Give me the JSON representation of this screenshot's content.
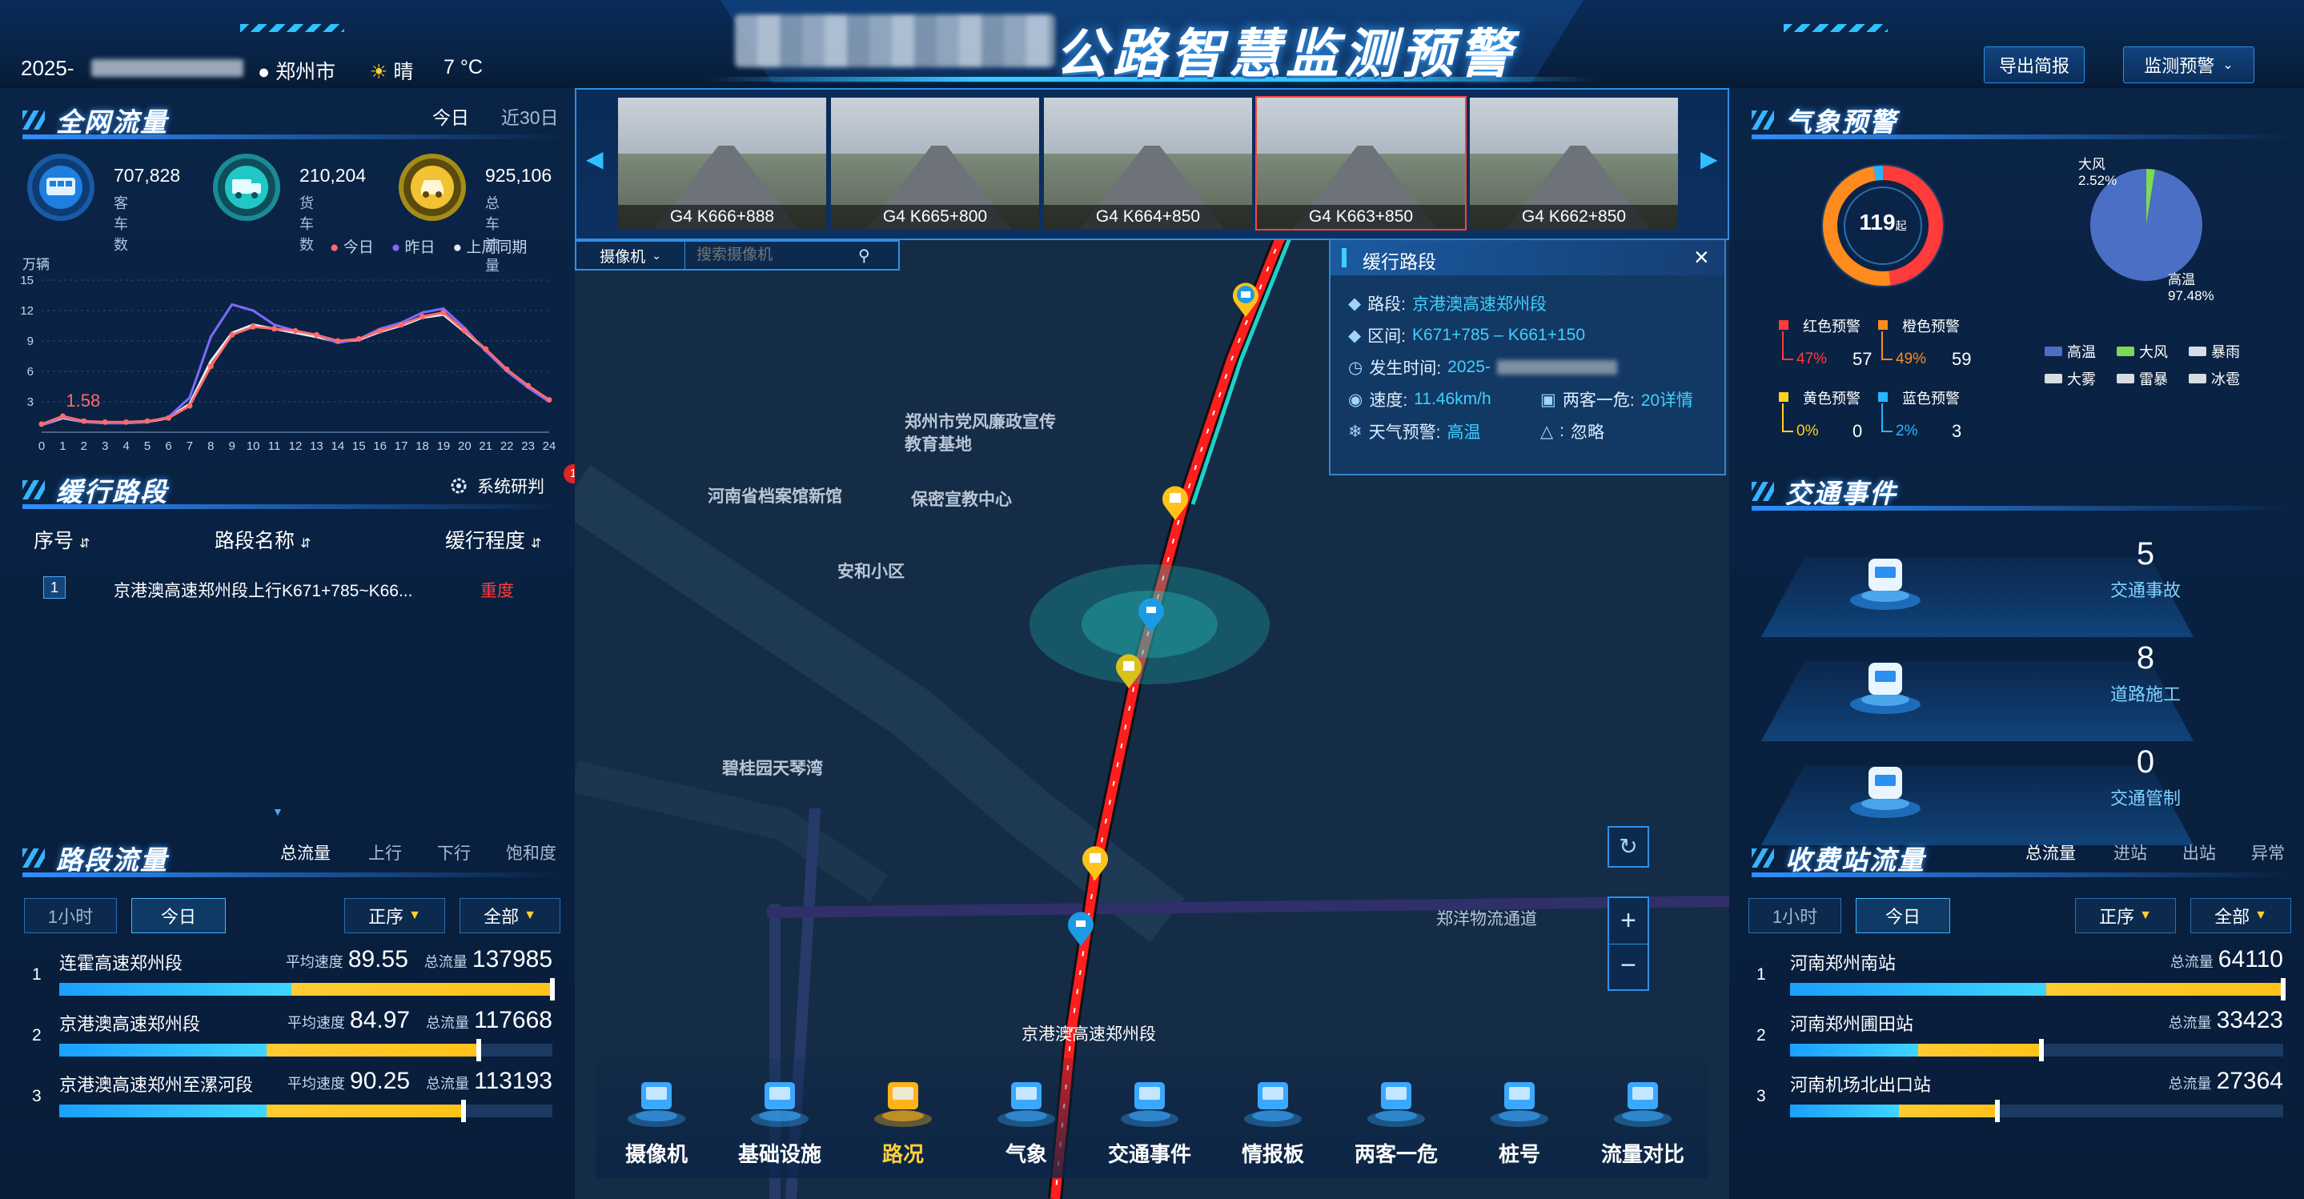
{
  "header": {
    "title": "公路智慧监测预警",
    "date_prefix": "2025-",
    "city": "郑州市",
    "weather": "晴",
    "temperature": "7 °C",
    "buttons": {
      "export": "导出简报",
      "monitor": "监测预警"
    }
  },
  "network_flow": {
    "title": "全网流量",
    "tabs": [
      "今日",
      "近30日"
    ],
    "kpis": [
      {
        "value": "707,828",
        "label": "客车数",
        "icon": "bus-icon",
        "color": "#1e7fe0"
      },
      {
        "value": "210,204",
        "label": "货车数",
        "icon": "truck-icon",
        "color": "#21c7c7"
      },
      {
        "value": "925,106",
        "label": "总车流量",
        "icon": "car-icon",
        "color": "#f1c232"
      }
    ],
    "legend": [
      "今日",
      "昨日",
      "上周同期"
    ],
    "unit": "万辆",
    "annotation": "1.58"
  },
  "chart_data": {
    "type": "line",
    "ylabel": "万辆",
    "x": [
      0,
      1,
      2,
      3,
      4,
      5,
      6,
      7,
      8,
      9,
      10,
      11,
      12,
      13,
      14,
      15,
      16,
      17,
      18,
      19,
      20,
      21,
      22,
      23,
      24
    ],
    "ylim": [
      0,
      15
    ],
    "yticks": [
      3,
      6,
      9,
      12,
      15
    ],
    "annotation": "1.58",
    "series": [
      {
        "name": "今日",
        "color": "#ff6b6b",
        "values": [
          0.8,
          1.58,
          1.1,
          1.0,
          1.0,
          1.1,
          1.4,
          2.6,
          6.5,
          9.6,
          10.4,
          10.2,
          10.0,
          9.6,
          9.0,
          9.2,
          10.0,
          10.6,
          11.4,
          11.8,
          10.0,
          8.2,
          6.2,
          4.6,
          3.2
        ]
      },
      {
        "name": "昨日",
        "color": "#7b6bff",
        "values": [
          0.7,
          1.5,
          1.0,
          0.9,
          0.9,
          1.0,
          1.5,
          3.4,
          9.4,
          12.6,
          12.0,
          10.6,
          10.0,
          9.6,
          8.8,
          9.2,
          10.2,
          10.8,
          11.8,
          12.2,
          10.3,
          8.0,
          6.0,
          4.4,
          3.0
        ]
      },
      {
        "name": "上周同期",
        "color": "#e6edf5",
        "values": [
          0.7,
          1.4,
          1.0,
          0.9,
          0.9,
          1.0,
          1.4,
          2.8,
          7.0,
          9.8,
          10.6,
          10.2,
          9.8,
          9.4,
          8.9,
          9.1,
          9.9,
          10.5,
          11.3,
          11.6,
          9.9,
          8.1,
          6.1,
          4.5,
          3.1
        ]
      }
    ]
  },
  "slow_roads": {
    "title": "缓行路段",
    "system_label": "系统研判",
    "badge": "1",
    "columns": [
      "序号",
      "路段名称",
      "缓行程度"
    ],
    "rows": [
      {
        "index": "1",
        "name": "京港澳高速郑州段上行K671+785~K66...",
        "level": "重度"
      }
    ]
  },
  "segment_flow": {
    "title": "路段流量",
    "tabs": [
      "总流量",
      "上行",
      "下行",
      "饱和度"
    ],
    "filters": [
      "1小时",
      "今日"
    ],
    "sort": "正序",
    "scope": "全部",
    "rows": [
      {
        "rank": "1",
        "name": "连霍高速郑州段",
        "speed_label": "平均速度",
        "speed": "89.55",
        "total_label": "总流量",
        "total": "137985",
        "blue": 0.47,
        "fill": 1.0
      },
      {
        "rank": "2",
        "name": "京港澳高速郑州段",
        "speed_label": "平均速度",
        "speed": "84.97",
        "total_label": "总流量",
        "total": "117668",
        "blue": 0.42,
        "fill": 0.85
      },
      {
        "rank": "3",
        "name": "京港澳高速郑州至漯河段",
        "speed_label": "平均速度",
        "speed": "90.25",
        "total_label": "总流量",
        "total": "113193",
        "blue": 0.42,
        "fill": 0.82
      }
    ]
  },
  "cameras": {
    "thumbs": [
      "G4 K666+888",
      "G4 K665+800",
      "G4 K664+850",
      "G4 K663+850",
      "G4 K662+850"
    ],
    "selected": 3,
    "type_select": "摄像机",
    "search_placeholder": "搜索摄像机"
  },
  "map": {
    "labels": [
      "郑州市党风廉政宣传教育基地",
      "河南省档案馆新馆",
      "保密宣教中心",
      "安和小区",
      "碧桂园天琴湾",
      "郑洋物流通道",
      "京港澳高速郑州段"
    ]
  },
  "popup": {
    "title": "缓行路段",
    "road_label": "路段:",
    "road": "京港澳高速郑州段",
    "range_label": "区间:",
    "range": "K671+785 – K661+150",
    "time_label": "发生时间:",
    "time": "2025-",
    "speed_label": "速度:",
    "speed": "11.46km/h",
    "hazard_label": "两客一危:",
    "hazard": "20详情",
    "weather_label": "天气预警:",
    "weather": "高温",
    "ignore_label": ":",
    "ignore": "忽略"
  },
  "toolbar": {
    "items": [
      {
        "label": "摄像机",
        "icon": "camera-icon"
      },
      {
        "label": "基础设施",
        "icon": "infrastructure-icon"
      },
      {
        "label": "路况",
        "icon": "road-condition-icon"
      },
      {
        "label": "气象",
        "icon": "weather-icon"
      },
      {
        "label": "交通事件",
        "icon": "traffic-event-icon"
      },
      {
        "label": "情报板",
        "icon": "info-board-icon"
      },
      {
        "label": "两客一危",
        "icon": "hazard-vehicle-icon"
      },
      {
        "label": "桩号",
        "icon": "stake-icon"
      },
      {
        "label": "流量对比",
        "icon": "flow-compare-icon"
      }
    ],
    "active": 2
  },
  "weather_alert": {
    "title": "气象预警",
    "gauge_value": "119",
    "gauge_unit": "起",
    "levels": [
      {
        "name": "红色预警",
        "pct": "47%",
        "count": "57",
        "color": "#ff3b3b"
      },
      {
        "name": "橙色预警",
        "pct": "49%",
        "count": "59",
        "color": "#ff8a1e"
      },
      {
        "name": "黄色预警",
        "pct": "0%",
        "count": "0",
        "color": "#ffd21e"
      },
      {
        "name": "蓝色预警",
        "pct": "2%",
        "count": "3",
        "color": "#27b6ff"
      }
    ],
    "pie": [
      {
        "name": "大风",
        "pct": "2.52%",
        "value": 2.52,
        "color": "#7ed957"
      },
      {
        "name": "高温",
        "pct": "97.48%",
        "value": 97.48,
        "color": "#4b6fc4"
      }
    ],
    "pie_legend": [
      {
        "name": "高温",
        "color": "#4b6fc4"
      },
      {
        "name": "大风",
        "color": "#7ed957"
      },
      {
        "name": "暴雨",
        "color": "#d8dde4"
      },
      {
        "name": "大雾",
        "color": "#d8dde4"
      },
      {
        "name": "雷暴",
        "color": "#d8dde4"
      },
      {
        "name": "冰雹",
        "color": "#d8dde4"
      }
    ]
  },
  "traffic_events": {
    "title": "交通事件",
    "items": [
      {
        "value": "5",
        "label": "交通事故"
      },
      {
        "value": "8",
        "label": "道路施工"
      },
      {
        "value": "0",
        "label": "交通管制"
      }
    ]
  },
  "toll_flow": {
    "title": "收费站流量",
    "tabs": [
      "总流量",
      "进站",
      "出站",
      "异常"
    ],
    "filters": [
      "1小时",
      "今日"
    ],
    "sort": "正序",
    "scope": "全部",
    "rows": [
      {
        "rank": "1",
        "name": "河南郑州南站",
        "total_label": "总流量",
        "total": "64110",
        "blue": 0.52,
        "fill": 1.0
      },
      {
        "rank": "2",
        "name": "河南郑州圃田站",
        "total_label": "总流量",
        "total": "33423",
        "blue": 0.26,
        "fill": 0.51
      },
      {
        "rank": "3",
        "name": "河南机场北出口站",
        "total_label": "总流量",
        "total": "27364",
        "blue": 0.22,
        "fill": 0.42
      }
    ]
  }
}
